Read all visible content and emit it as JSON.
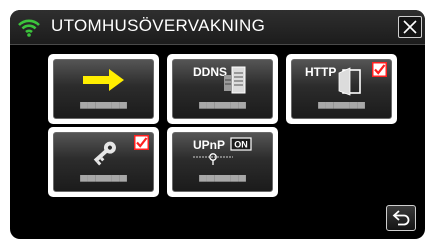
{
  "header": {
    "title": "UTOMHUSÖVERVAKNING",
    "wifi_icon": "wifi-icon",
    "close_icon": "close-icon"
  },
  "tiles": [
    {
      "id": "forward",
      "icon": "arrow-right-icon",
      "label": "▀▀▀▀▀▀",
      "checked": false
    },
    {
      "id": "ddns",
      "icon": "ddns-icon",
      "icon_text": "DDNS",
      "label": "▀▀▀▀▀▀",
      "checked": false
    },
    {
      "id": "http",
      "icon": "http-icon",
      "icon_text": "HTTP",
      "label": "▀▀▀▀▀▀",
      "checked": true
    },
    {
      "id": "password",
      "icon": "key-icon",
      "label": "▀▀▀▀▀▀",
      "checked": true
    },
    {
      "id": "upnp",
      "icon": "upnp-icon",
      "icon_text": "UPnP",
      "badge": "ON",
      "label": "▀▀▀▀▀▀",
      "checked": false
    }
  ],
  "footer": {
    "back_icon": "back-icon"
  },
  "colors": {
    "background": "#000000",
    "wifi": "#3cc43c",
    "arrow": "#ffee00",
    "check_border": "#ff2020",
    "tile_frame": "#ffffff"
  }
}
